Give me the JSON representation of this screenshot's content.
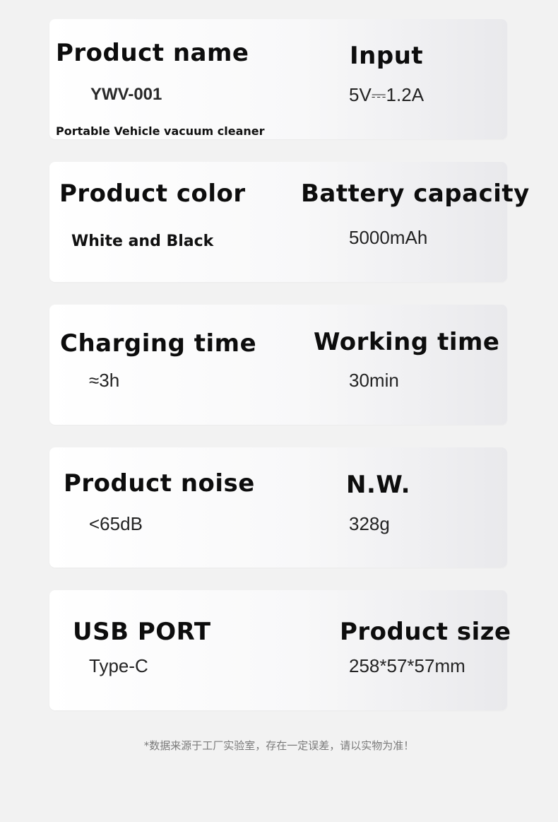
{
  "specs": [
    {
      "left_label": "Product name",
      "left_value": "YWV-001",
      "left_note": "Portable Vehicle vacuum cleaner",
      "right_label": "Input",
      "right_value": "5V⎓1.2A"
    },
    {
      "left_label": "Product color",
      "left_value": "White and Black",
      "right_label": "Battery capacity",
      "right_value": "5000mAh"
    },
    {
      "left_label": "Charging time",
      "left_value": "≈3h",
      "right_label": "Working time",
      "right_value": "30min"
    },
    {
      "left_label": "Product noise",
      "left_value": "<65dB",
      "right_label": "N.W.",
      "right_value": "328g"
    },
    {
      "left_label": "USB PORT",
      "left_value": "Type-C",
      "right_label": "Product size",
      "right_value": "258*57*57mm"
    }
  ],
  "footnote": "*数据来源于工厂实验室，存在一定误差，请以实物为准！"
}
